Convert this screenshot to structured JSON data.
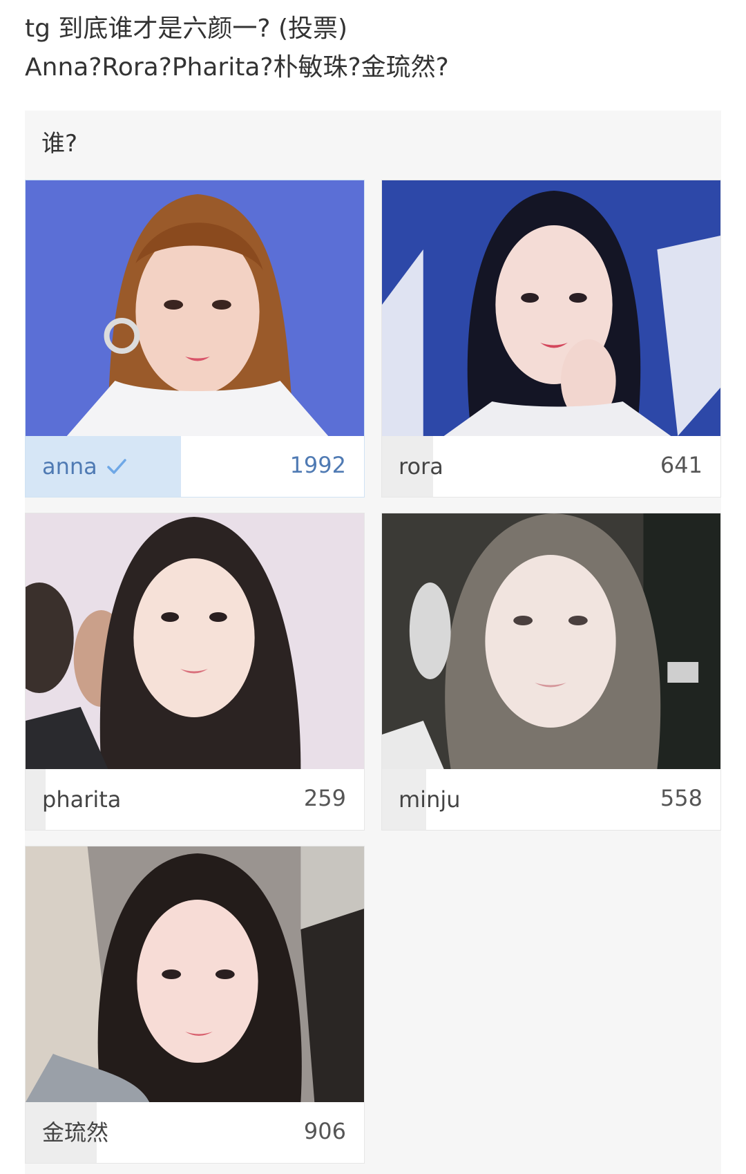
{
  "post": {
    "title_line1": "tg 到底谁才是六颜一? (投票)",
    "title_line2": "Anna?Rora?Pharita?朴敏珠?金琉然?"
  },
  "poll": {
    "question": "谁?",
    "accent_color": "#4f7ab3",
    "options": [
      {
        "name": "anna",
        "votes": "1992",
        "share": 0.46,
        "voted": true,
        "check_icon": "checkmark-icon",
        "photo_bg": "#5b6fd6"
      },
      {
        "name": "rora",
        "votes": "641",
        "share": 0.15,
        "voted": false,
        "photo_bg": "#2d48a8"
      },
      {
        "name": "pharita",
        "votes": "259",
        "share": 0.06,
        "voted": false,
        "photo_bg": "#e9dfe8"
      },
      {
        "name": "minju",
        "votes": "558",
        "share": 0.13,
        "voted": false,
        "photo_bg": "#3b3a36"
      },
      {
        "name": "金琉然",
        "votes": "906",
        "share": 0.21,
        "voted": false,
        "photo_bg": "#9a9490"
      }
    ]
  }
}
